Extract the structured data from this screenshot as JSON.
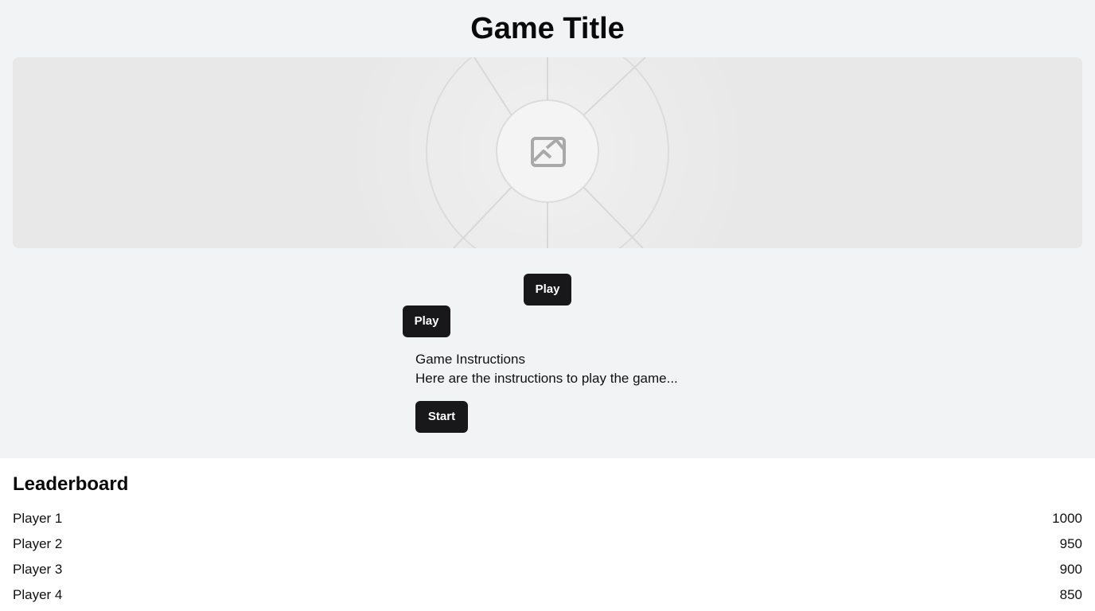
{
  "header": {
    "title": "Game Title"
  },
  "hero": {
    "icon": "image-placeholder-icon"
  },
  "buttons": {
    "play_primary": "Play",
    "play_secondary": "Play",
    "start": "Start"
  },
  "instructions": {
    "title": "Game Instructions",
    "text": "Here are the instructions to play the game..."
  },
  "leaderboard": {
    "title": "Leaderboard",
    "entries": [
      {
        "name": "Player 1",
        "score": "1000"
      },
      {
        "name": "Player 2",
        "score": "950"
      },
      {
        "name": "Player 3",
        "score": "900"
      },
      {
        "name": "Player 4",
        "score": "850"
      }
    ]
  },
  "colors": {
    "page_background": "#f2f3f5",
    "button_background": "#18181b",
    "button_text": "#ffffff",
    "placeholder_background": "#e8e8e8"
  }
}
